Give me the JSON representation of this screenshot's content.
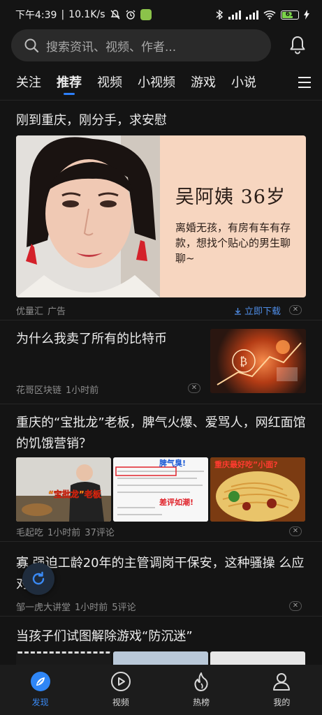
{
  "status_bar": {
    "time": "下午4:39",
    "speed": "10.1K/s",
    "battery": "61",
    "network": "HD"
  },
  "search": {
    "placeholder": "搜索资讯、视频、作者..."
  },
  "tabs": [
    {
      "label": "关注"
    },
    {
      "label": "推荐",
      "active": true
    },
    {
      "label": "视频"
    },
    {
      "label": "小视频"
    },
    {
      "label": "游戏"
    },
    {
      "label": "小说"
    }
  ],
  "feed": {
    "ad": {
      "title": "刚到重庆，刚分手，求安慰",
      "name_age": "吴阿姨  36岁",
      "desc": "离婚无孩，有房有车有存款，想找个贴心的男生聊聊~",
      "source": "优量汇",
      "tag": "广告",
      "download": "立即下载"
    },
    "item1": {
      "title": "为什么我卖了所有的比特币",
      "source": "花哥区块链",
      "time": "1小时前"
    },
    "item2": {
      "title": "重庆的“宝批龙”老板，脾气火爆、爱骂人，网红面馆的饥饿营销？",
      "source": "毛起吃",
      "time": "1小时前",
      "comments": "37评论",
      "thumb1_caption": "“宝批龙”老板",
      "thumb2_caption_top": "脾气臭!",
      "thumb2_caption_bottom": "差评如潮!",
      "thumb3_caption": "重庆最好吃”小面?"
    },
    "item3": {
      "title": "寡 强迫工龄20年的主管调岗干保安，这种骚操 么应对？",
      "source": "邹一虎大讲堂",
      "time": "1小时前",
      "comments": "5评论"
    },
    "item4": {
      "title": "当孩子们试图解除游戏“防沉迷”"
    }
  },
  "bottom_nav": [
    {
      "label": "发现",
      "icon": "discover-icon",
      "active": true
    },
    {
      "label": "视频",
      "icon": "play-icon"
    },
    {
      "label": "热榜",
      "icon": "flame-icon"
    },
    {
      "label": "我的",
      "icon": "person-icon"
    }
  ],
  "colors": {
    "accent": "#2d7ff9",
    "background": "#141414",
    "ad_background": "#f7d6c0"
  }
}
